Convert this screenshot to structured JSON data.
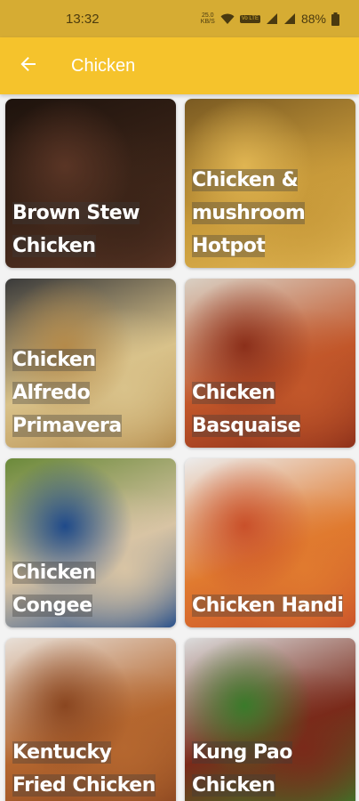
{
  "status_bar": {
    "time": "13:32",
    "speed_value": "25.0",
    "speed_unit": "KB/S",
    "volte_label": "Vo LTE",
    "battery_percent": "88%"
  },
  "app_bar": {
    "title": "Chicken",
    "back_icon": "arrow-back-icon"
  },
  "recipes": [
    {
      "name": "Brown Stew Chicken",
      "colors": [
        "#3b2418",
        "#5a3525",
        "#1e130d"
      ]
    },
    {
      "name": "Chicken & mushroom Hotpot",
      "colors": [
        "#c89a3a",
        "#e0b552",
        "#7a5a22"
      ]
    },
    {
      "name": "Chicken Alfredo Primavera",
      "colors": [
        "#d9c28a",
        "#b48a4a",
        "#3a3a3a"
      ]
    },
    {
      "name": "Chicken Basquaise",
      "colors": [
        "#c2572a",
        "#8b2f1a",
        "#d9d0c4"
      ]
    },
    {
      "name": "Chicken Congee",
      "colors": [
        "#d8c4a4",
        "#1f4a8a",
        "#6b8a3a"
      ]
    },
    {
      "name": "Chicken Handi",
      "colors": [
        "#e07a2f",
        "#c9502a",
        "#ececec"
      ]
    },
    {
      "name": "Kentucky Fried Chicken",
      "colors": [
        "#b5672f",
        "#8a4620",
        "#e8e0d8"
      ]
    },
    {
      "name": "Kung Pao Chicken",
      "colors": [
        "#7a2a1a",
        "#3a7a2a",
        "#dcdcdc"
      ]
    }
  ]
}
